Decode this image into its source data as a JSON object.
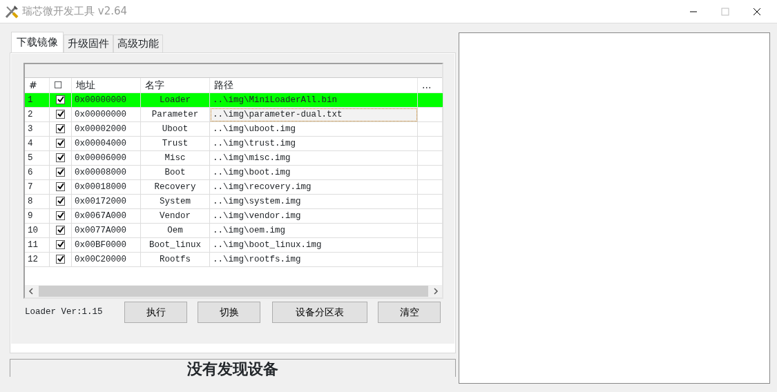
{
  "window": {
    "title": "瑞芯微开发工具 v2.64"
  },
  "tabs": [
    {
      "label": "下载镜像",
      "selected": true
    },
    {
      "label": "升级固件",
      "selected": false
    },
    {
      "label": "高级功能",
      "selected": false
    }
  ],
  "table": {
    "columns": [
      "#",
      "☐",
      "地址",
      "名字",
      "路径",
      "..."
    ],
    "rows": [
      {
        "index": "1",
        "checked": true,
        "address": "0x00000000",
        "name": "Loader",
        "path": "..\\img\\MiniLoaderAll.bin",
        "selected": true,
        "focused": false
      },
      {
        "index": "2",
        "checked": true,
        "address": "0x00000000",
        "name": "Parameter",
        "path": "..\\img\\parameter-dual.txt",
        "selected": false,
        "focused": true
      },
      {
        "index": "3",
        "checked": true,
        "address": "0x00002000",
        "name": "Uboot",
        "path": "..\\img\\uboot.img",
        "selected": false,
        "focused": false
      },
      {
        "index": "4",
        "checked": true,
        "address": "0x00004000",
        "name": "Trust",
        "path": "..\\img\\trust.img",
        "selected": false,
        "focused": false
      },
      {
        "index": "5",
        "checked": true,
        "address": "0x00006000",
        "name": "Misc",
        "path": "..\\img\\misc.img",
        "selected": false,
        "focused": false
      },
      {
        "index": "6",
        "checked": true,
        "address": "0x00008000",
        "name": "Boot",
        "path": "..\\img\\boot.img",
        "selected": false,
        "focused": false
      },
      {
        "index": "7",
        "checked": true,
        "address": "0x00018000",
        "name": "Recovery",
        "path": "..\\img\\recovery.img",
        "selected": false,
        "focused": false
      },
      {
        "index": "8",
        "checked": true,
        "address": "0x00172000",
        "name": "System",
        "path": "..\\img\\system.img",
        "selected": false,
        "focused": false
      },
      {
        "index": "9",
        "checked": true,
        "address": "0x0067A000",
        "name": "Vendor",
        "path": "..\\img\\vendor.img",
        "selected": false,
        "focused": false
      },
      {
        "index": "10",
        "checked": true,
        "address": "0x0077A000",
        "name": "Oem",
        "path": "..\\img\\oem.img",
        "selected": false,
        "focused": false
      },
      {
        "index": "11",
        "checked": true,
        "address": "0x00BF0000",
        "name": "Boot_linux",
        "path": "..\\img\\boot_linux.img",
        "selected": false,
        "focused": false
      },
      {
        "index": "12",
        "checked": true,
        "address": "0x00C20000",
        "name": "Rootfs",
        "path": "..\\img\\rootfs.img",
        "selected": false,
        "focused": false
      }
    ]
  },
  "loader_version": "Loader Ver:1.15",
  "buttons": [
    "执行",
    "切换",
    "设备分区表",
    "清空"
  ],
  "status": "没有发现设备"
}
